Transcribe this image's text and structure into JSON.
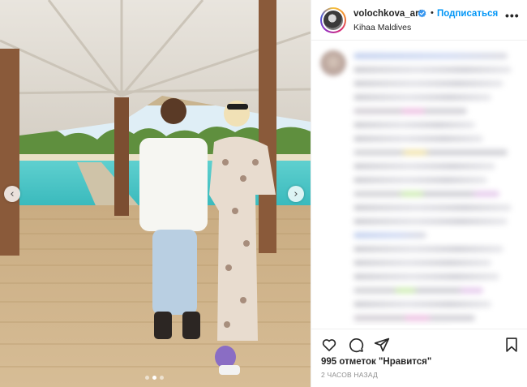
{
  "post": {
    "username": "volochkova_art",
    "follow_label": "Подписаться",
    "separator": "•",
    "location": "Kihaa Maldives",
    "more_label": "•••",
    "likes": "995 отметок \"Нравится\"",
    "timestamp": "2 ЧАСОВ НАЗАД"
  },
  "media": {
    "carousel_total": 3,
    "carousel_active": 2,
    "prev_glyph": "‹",
    "next_glyph": "›"
  },
  "icons": {
    "verified": "verified-badge-icon",
    "like": "heart-icon",
    "comment": "comment-bubble-icon",
    "share": "paper-plane-icon",
    "save": "bookmark-icon",
    "more": "ellipsis-icon"
  },
  "colors": {
    "link": "#0095f6",
    "text": "#262626",
    "muted": "#8e8e8e"
  }
}
